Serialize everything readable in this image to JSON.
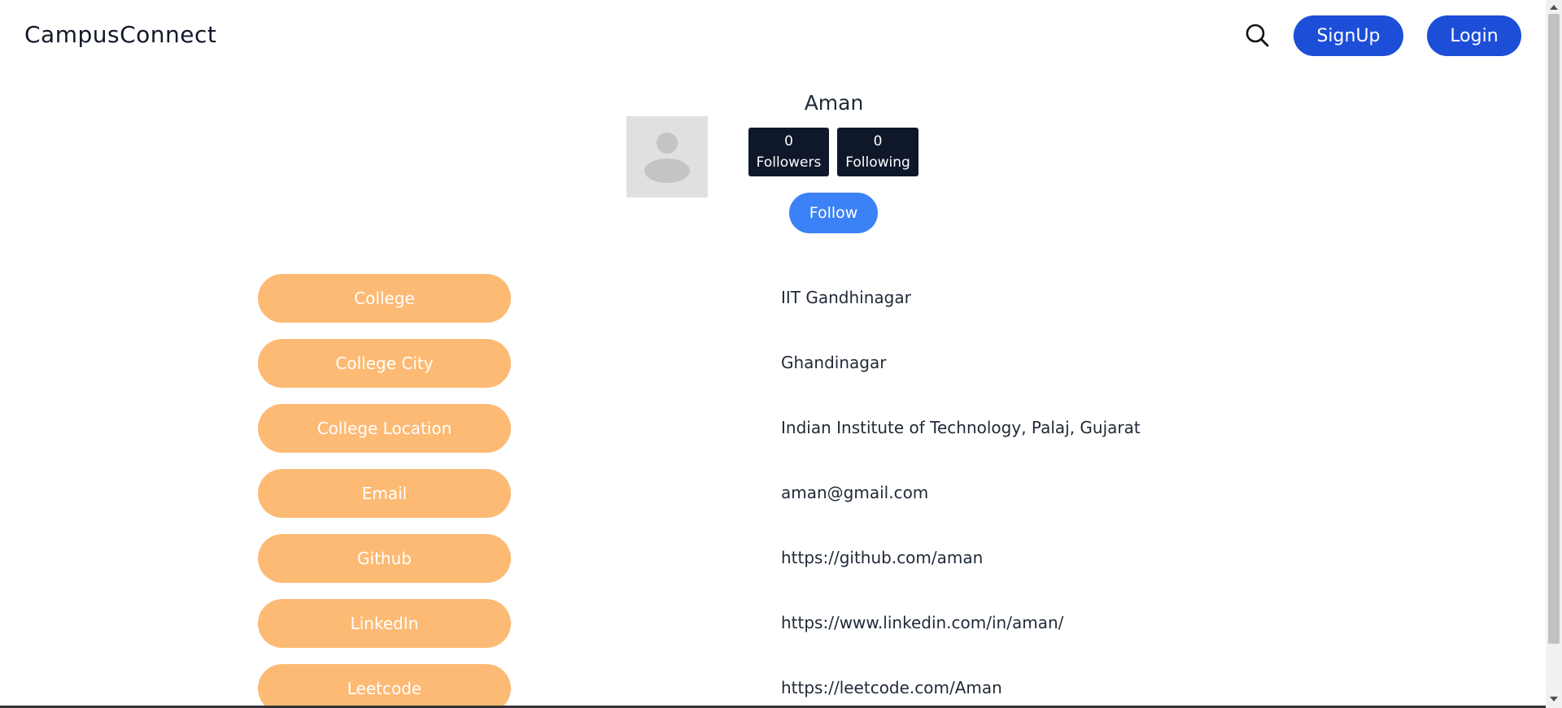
{
  "header": {
    "brand": "CampusConnect",
    "signup_label": "SignUp",
    "login_label": "Login",
    "search_icon": "search-icon"
  },
  "profile": {
    "name": "Aman",
    "followers_count": "0",
    "followers_label": "Followers",
    "following_count": "0",
    "following_label": "Following",
    "follow_label": "Follow",
    "avatar_icon": "user-placeholder-icon"
  },
  "details": [
    {
      "label": "College",
      "value": "IIT Gandhinagar"
    },
    {
      "label": "College City",
      "value": "Ghandinagar"
    },
    {
      "label": "College Location",
      "value": "Indian Institute of Technology, Palaj, Gujarat"
    },
    {
      "label": "Email",
      "value": "aman@gmail.com"
    },
    {
      "label": "Github",
      "value": "https://github.com/aman"
    },
    {
      "label": "LinkedIn",
      "value": "https://www.linkedin.com/in/aman/"
    },
    {
      "label": "Leetcode",
      "value": "https://leetcode.com/Aman"
    }
  ],
  "colors": {
    "primary_blue": "#1d4ed8",
    "follow_blue": "#3b82f6",
    "stat_dark": "#0f172a",
    "label_orange": "#fdba74"
  }
}
